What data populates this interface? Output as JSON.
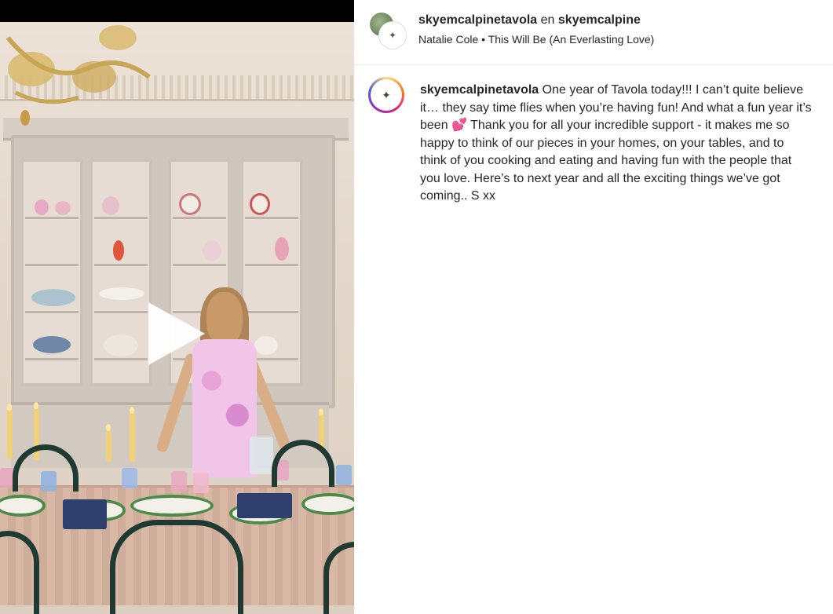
{
  "header": {
    "username": "skyemcalpinetavola",
    "connector": "en",
    "collab_username": "skyemcalpine",
    "audio": "Natalie Cole • This Will Be (An Everlasting Love)"
  },
  "caption": {
    "username": "skyemcalpinetavola",
    "text_before_emoji": " One year of Tavola today!!! I can’t quite believe it… they say time flies when you’re having fun! And what a fun year it’s been ",
    "emoji": "💕",
    "text_after_emoji": " Thank you for all your incredible support - it makes me so happy to think of our pieces in your homes, on your tables, and to think of you cooking and eating and having fun with the people that you love. Here’s to next year and all the exciting things we’ve got coming.. S xx"
  },
  "media": {
    "type": "video",
    "state": "paused"
  },
  "icons": {
    "play": "play-icon",
    "avatar": "profile-avatar-icon"
  },
  "colors": {
    "accent_ring": "#d62976",
    "text": "#262626",
    "divider": "#efefef"
  }
}
